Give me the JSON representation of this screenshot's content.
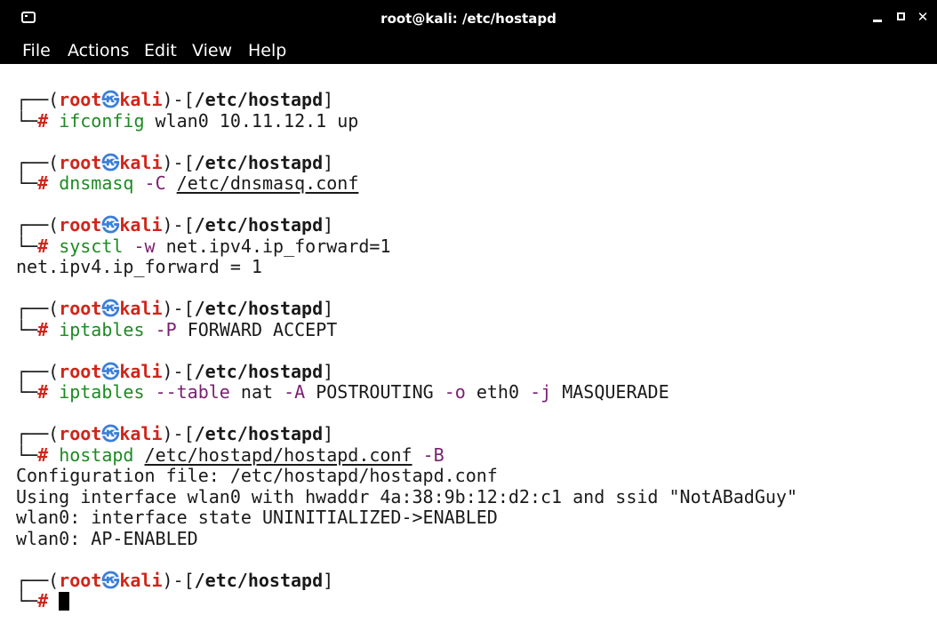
{
  "window": {
    "title": "root@kali: /etc/hostapd",
    "controls": {
      "minimize": "_",
      "maximize": "□",
      "close": "×"
    }
  },
  "menu": [
    "File",
    "Actions",
    "Edit",
    "View",
    "Help"
  ],
  "prompt": {
    "open": "┌──(",
    "user": "root",
    "sep": "㉿",
    "host": "kali",
    "mid": ")-[",
    "path": "/etc/hostapd",
    "close": "]",
    "corner": "└─",
    "hash": "#"
  },
  "blocks": [
    {
      "cmd": [
        {
          "t": "ifconfig",
          "c": "cmd"
        },
        {
          "t": " wlan0 10.11.12.1 up",
          "c": "arg"
        }
      ],
      "output": []
    },
    {
      "cmd": [
        {
          "t": "dnsmasq",
          "c": "cmd"
        },
        {
          "t": " ",
          "c": "arg"
        },
        {
          "t": "-C",
          "c": "opt"
        },
        {
          "t": " ",
          "c": "arg"
        },
        {
          "t": "/etc/dnsmasq.conf",
          "c": "arg ul"
        }
      ],
      "output": []
    },
    {
      "cmd": [
        {
          "t": "sysctl",
          "c": "cmd"
        },
        {
          "t": " ",
          "c": "arg"
        },
        {
          "t": "-w",
          "c": "opt"
        },
        {
          "t": " net.ipv4.ip_forward=1",
          "c": "arg"
        }
      ],
      "output": [
        "net.ipv4.ip_forward = 1"
      ]
    },
    {
      "cmd": [
        {
          "t": "iptables",
          "c": "cmd"
        },
        {
          "t": " ",
          "c": "arg"
        },
        {
          "t": "-P",
          "c": "opt"
        },
        {
          "t": " FORWARD ACCEPT",
          "c": "arg"
        }
      ],
      "output": []
    },
    {
      "cmd": [
        {
          "t": "iptables",
          "c": "cmd"
        },
        {
          "t": " ",
          "c": "arg"
        },
        {
          "t": "--table",
          "c": "opt"
        },
        {
          "t": " nat ",
          "c": "arg"
        },
        {
          "t": "-A",
          "c": "opt"
        },
        {
          "t": " POSTROUTING ",
          "c": "arg"
        },
        {
          "t": "-o",
          "c": "opt"
        },
        {
          "t": " eth0 ",
          "c": "arg"
        },
        {
          "t": "-j",
          "c": "opt"
        },
        {
          "t": " MASQUERADE",
          "c": "arg"
        }
      ],
      "output": []
    },
    {
      "cmd": [
        {
          "t": "hostapd",
          "c": "cmd"
        },
        {
          "t": " ",
          "c": "arg"
        },
        {
          "t": "/etc/hostapd/hostapd.conf",
          "c": "arg ul"
        },
        {
          "t": " ",
          "c": "arg"
        },
        {
          "t": "-B",
          "c": "opt"
        }
      ],
      "output": [
        "Configuration file: /etc/hostapd/hostapd.conf",
        "Using interface wlan0 with hwaddr 4a:38:9b:12:d2:c1 and ssid \"NotABadGuy\"",
        "wlan0: interface state UNINITIALIZED->ENABLED",
        "wlan0: AP-ENABLED"
      ]
    },
    {
      "cmd": [],
      "output": [],
      "cursor": true
    }
  ],
  "colors": {
    "prompt_user": "#d0251b",
    "skull": "#3b7fd8",
    "command": "#1d8a23",
    "option": "#7a1f70",
    "titlebar": "#000000"
  }
}
